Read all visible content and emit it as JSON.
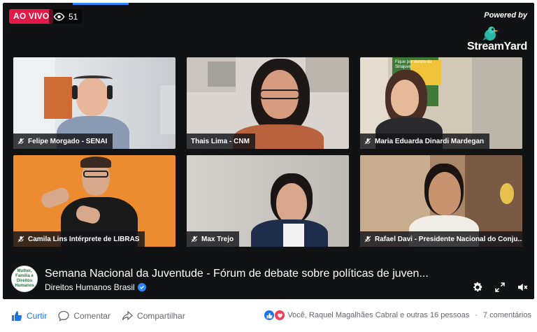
{
  "live": {
    "label": "AO VIVO",
    "viewers": "51"
  },
  "brand": {
    "powered": "Powered by",
    "name": "StreamYard"
  },
  "participants": [
    {
      "name": "Felipe Morgado - SENAI"
    },
    {
      "name": "Thais Lima - CNM"
    },
    {
      "name": "Maria Eduarda Dinardi Mardegan"
    },
    {
      "name": "Camila Lins Intérprete de LIBRAS"
    },
    {
      "name": "Max Trejo"
    },
    {
      "name": "Rafael Davi - Presidente Nacional do Conju..."
    }
  ],
  "banner_text": "Fique por dentro da Sinajuve",
  "video": {
    "title": "Semana Nacional da Juventude - Fórum de debate sobre políticas de juven...",
    "channel": "Direitos Humanos Brasil",
    "avatar_text": "Mulher, Família e Direitos Humanos"
  },
  "actions": {
    "like": "Curtir",
    "comment": "Comentar",
    "share": "Compartilhar"
  },
  "reactions": {
    "text": "Você, Raquel Magalhães Cabral e outras 16 pessoas",
    "comments": "7 comentários"
  },
  "colors": {
    "live": "#e4194a",
    "accent": "#1b74e4",
    "player_bg": "#111214"
  }
}
